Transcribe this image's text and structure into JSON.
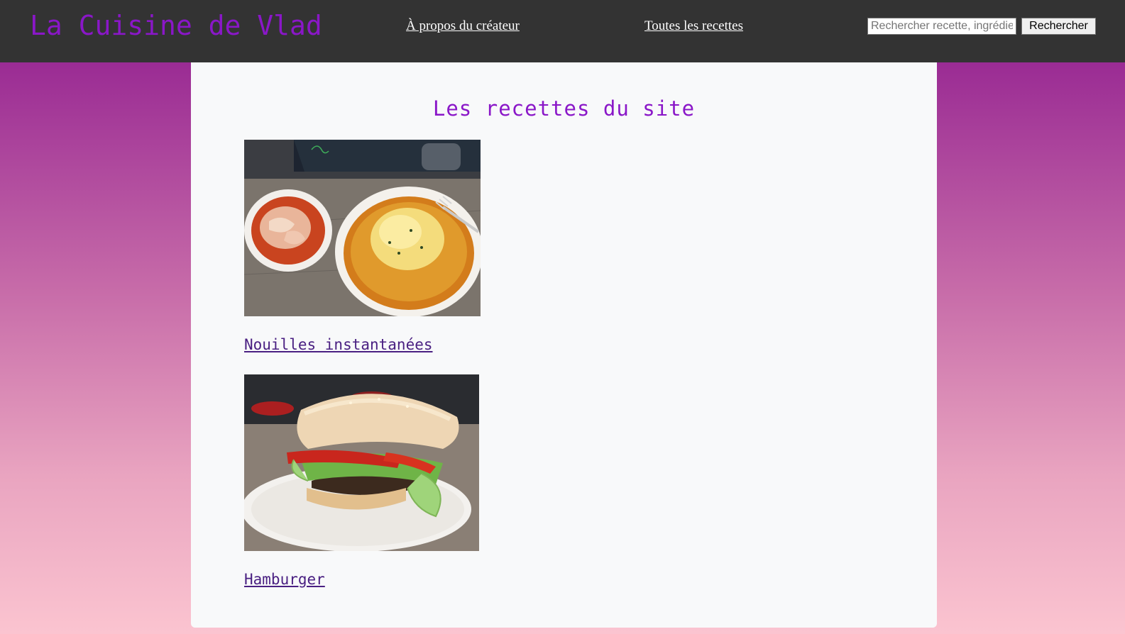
{
  "header": {
    "site_title": "La Cuisine de Vlad",
    "nav": {
      "about_label": "À propos du créateur",
      "all_recipes_label": "Toutes les recettes"
    },
    "search": {
      "placeholder": "Rechercher recette, ingrédient",
      "value": "",
      "button_label": "Rechercher"
    }
  },
  "main": {
    "heading": "Les recettes du site",
    "recipes": [
      {
        "title": "Nouilles instantanées",
        "image": "instant-noodles-with-kimchi-photo"
      },
      {
        "title": "Hamburger",
        "image": "hamburger-photo"
      }
    ]
  },
  "colors": {
    "header_bg": "#333333",
    "accent_purple": "#8a17c8",
    "link_purple": "#4a2082",
    "card_bg": "#f8f9fa",
    "gradient_top": "#8e1a8e",
    "gradient_bottom": "#fbc4d0"
  }
}
